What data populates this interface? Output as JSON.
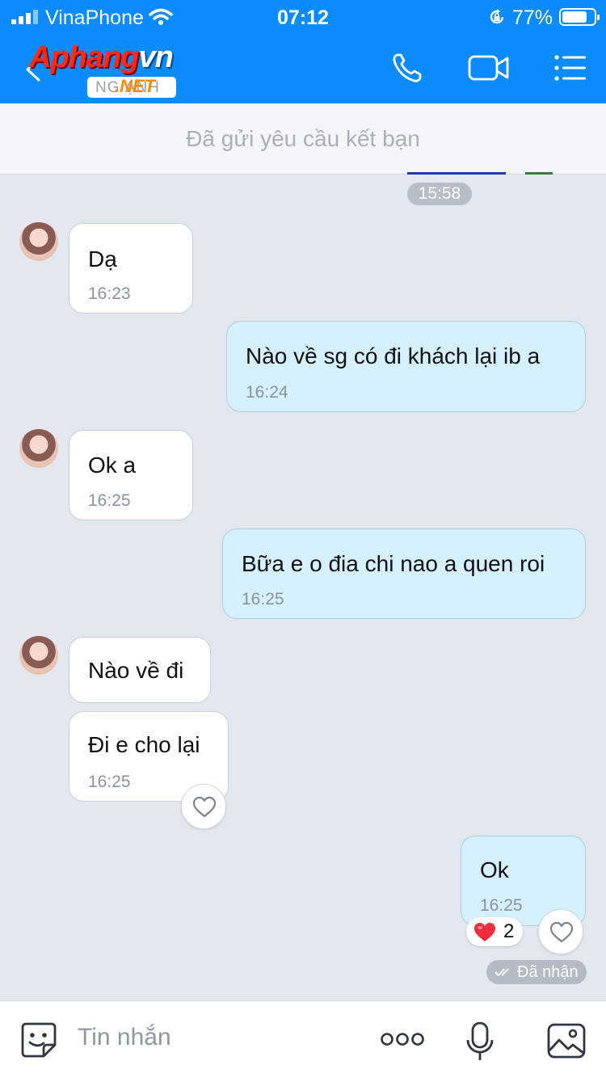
{
  "status_bar": {
    "carrier": "VinaPhone",
    "time": "07:12",
    "battery_percent": "77%",
    "icons": [
      "signal-icon",
      "wifi-icon",
      "rotation-lock-icon",
      "battery-icon"
    ]
  },
  "header": {
    "logo_text_red": "Aphang",
    "logo_text_white": "vn",
    "logo_sub": ".NET",
    "contact_name_partial": "NG    ẠNH",
    "actions": [
      "back-icon",
      "phone-icon",
      "video-call-icon",
      "menu-icon"
    ]
  },
  "friend_request_banner": "Đã gửi yêu cầu kết bạn",
  "date_pill": "15:58",
  "messages": [
    {
      "side": "in",
      "text": "Dạ",
      "time": "16:23"
    },
    {
      "side": "out",
      "text": "Nào về sg có đi khách lại ib a",
      "time": "16:24"
    },
    {
      "side": "in",
      "text": "Ok a",
      "time": "16:25"
    },
    {
      "side": "out",
      "text": "Bữa e o đia chi nao a quen roi",
      "time": "16:25"
    },
    {
      "side": "in",
      "text": "Nào về đi",
      "time": ""
    },
    {
      "side": "in",
      "text": "Đi e cho lại",
      "time": "16:25"
    },
    {
      "side": "out",
      "text": "Ok",
      "time": "16:25"
    }
  ],
  "reaction": {
    "emoji": "heart",
    "count": "2"
  },
  "received_status": "Đã nhận",
  "input": {
    "placeholder": "Tin nhắn",
    "icons": [
      "sticker-icon",
      "more-icon",
      "microphone-icon",
      "image-icon"
    ]
  },
  "colors": {
    "header_blue": "#0a8cff",
    "chat_background": "#e3e8ef",
    "outgoing_bubble": "#d5f0fe",
    "incoming_bubble": "#ffffff",
    "heart_red": "#ee2d3e"
  }
}
